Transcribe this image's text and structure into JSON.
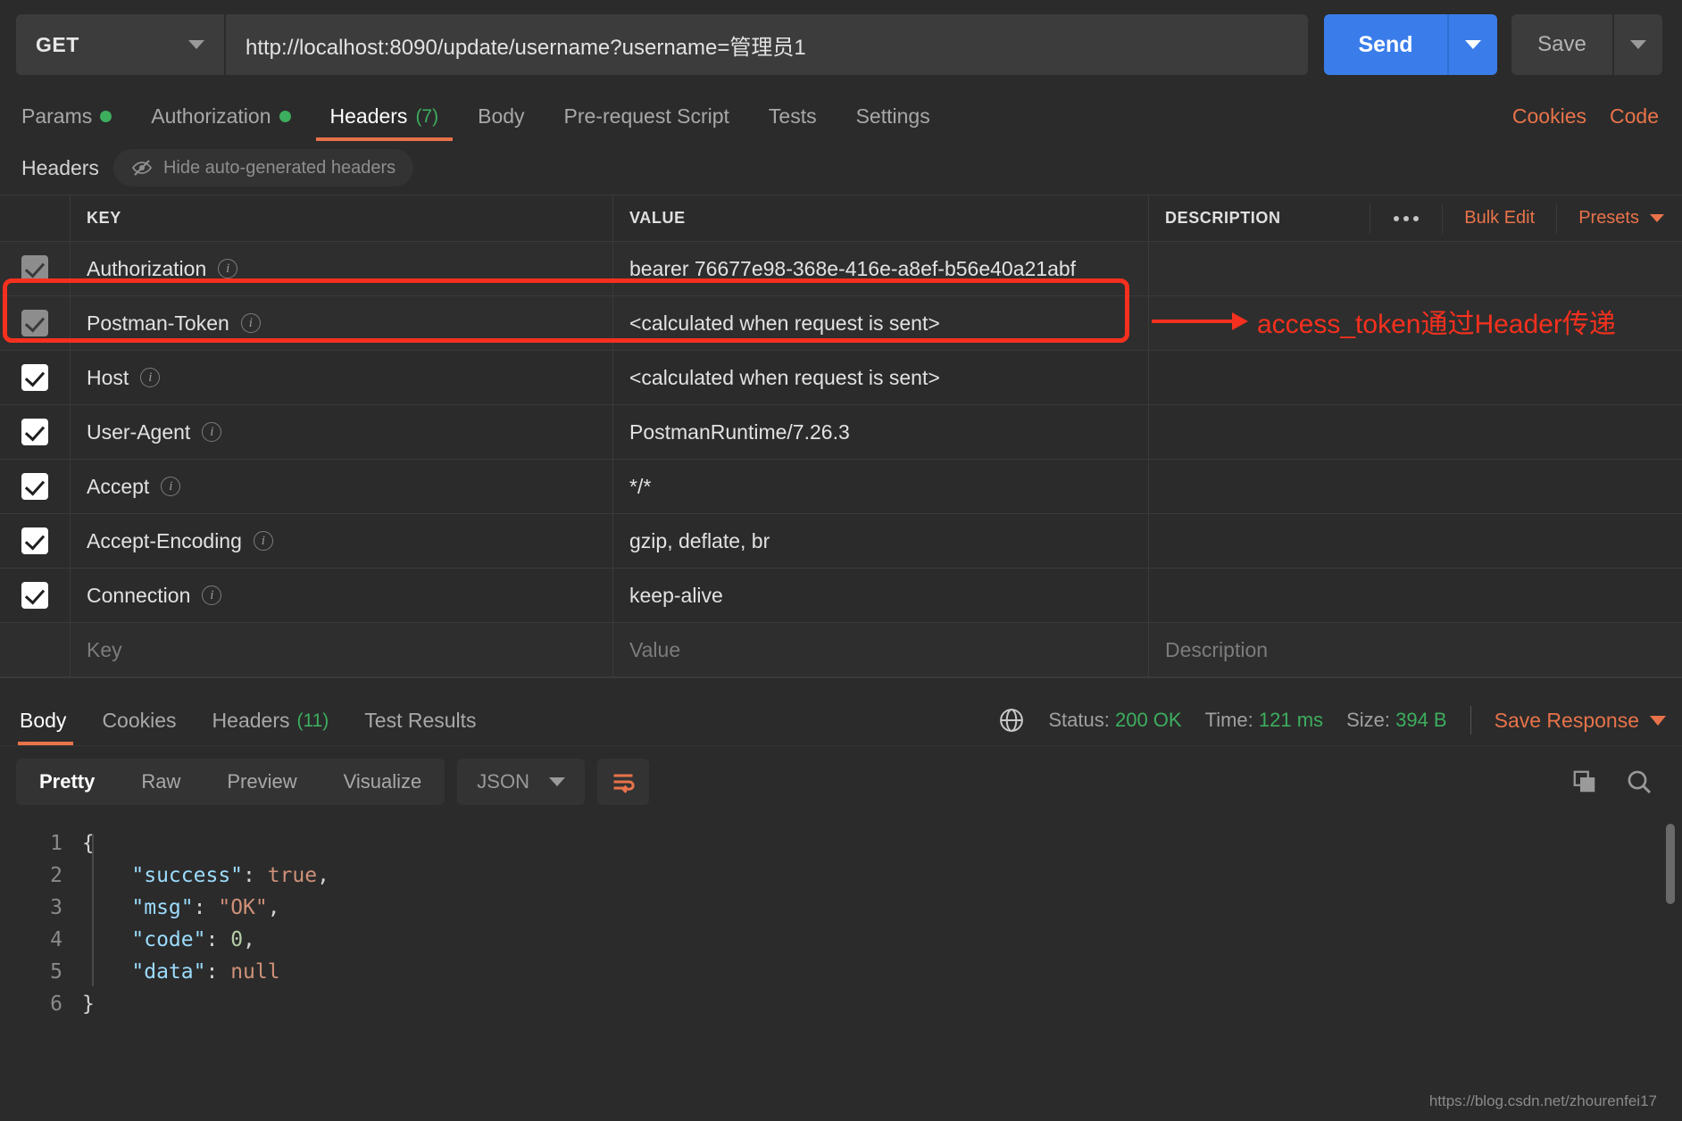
{
  "request": {
    "method": "GET",
    "url": "http://localhost:8090/update/username?username=管理员1",
    "send_label": "Send",
    "save_label": "Save"
  },
  "request_tabs": [
    {
      "label": "Params",
      "badge": "dot",
      "active": false
    },
    {
      "label": "Authorization",
      "badge": "dot",
      "active": false
    },
    {
      "label": "Headers",
      "badge": "(7)",
      "active": true
    },
    {
      "label": "Body",
      "badge": "",
      "active": false
    },
    {
      "label": "Pre-request Script",
      "badge": "",
      "active": false
    },
    {
      "label": "Tests",
      "badge": "",
      "active": false
    },
    {
      "label": "Settings",
      "badge": "",
      "active": false
    }
  ],
  "tabs_right": [
    {
      "label": "Cookies"
    },
    {
      "label": "Code"
    }
  ],
  "headers_panel": {
    "title": "Headers",
    "hide_auto_label": "Hide auto-generated headers",
    "columns": {
      "key": "KEY",
      "value": "VALUE",
      "description": "DESCRIPTION"
    },
    "bulk_edit": "Bulk Edit",
    "presets": "Presets",
    "placeholder_row": {
      "key": "Key",
      "value": "Value",
      "description": "Description"
    },
    "rows": [
      {
        "checked": true,
        "auto": true,
        "key": "Authorization",
        "value": "bearer 76677e98-368e-416e-a8ef-b56e40a21abf",
        "description": ""
      },
      {
        "checked": true,
        "auto": true,
        "key": "Postman-Token",
        "value": "<calculated when request is sent>",
        "description": ""
      },
      {
        "checked": true,
        "auto": false,
        "key": "Host",
        "value": "<calculated when request is sent>",
        "description": ""
      },
      {
        "checked": true,
        "auto": false,
        "key": "User-Agent",
        "value": "PostmanRuntime/7.26.3",
        "description": ""
      },
      {
        "checked": true,
        "auto": false,
        "key": "Accept",
        "value": "*/*",
        "description": ""
      },
      {
        "checked": true,
        "auto": false,
        "key": "Accept-Encoding",
        "value": "gzip, deflate, br",
        "description": ""
      },
      {
        "checked": true,
        "auto": false,
        "key": "Connection",
        "value": "keep-alive",
        "description": ""
      }
    ]
  },
  "annotation": {
    "text": "access_token通过Header传递",
    "color": "#f5301e"
  },
  "response": {
    "tabs": [
      {
        "label": "Body",
        "badge": "",
        "active": true
      },
      {
        "label": "Cookies",
        "badge": "",
        "active": false
      },
      {
        "label": "Headers",
        "badge": "(11)",
        "active": false
      },
      {
        "label": "Test Results",
        "badge": "",
        "active": false
      }
    ],
    "status_label": "Status:",
    "status_value": "200 OK",
    "time_label": "Time:",
    "time_value": "121 ms",
    "size_label": "Size:",
    "size_value": "394 B",
    "save_response": "Save Response",
    "view_modes": [
      {
        "label": "Pretty",
        "active": true
      },
      {
        "label": "Raw",
        "active": false
      },
      {
        "label": "Preview",
        "active": false
      },
      {
        "label": "Visualize",
        "active": false
      }
    ],
    "format": "JSON",
    "body_lines": [
      {
        "n": "1",
        "tokens": [
          {
            "t": "punc",
            "s": "{"
          }
        ]
      },
      {
        "n": "2",
        "tokens": [
          {
            "t": "punc",
            "s": "    "
          },
          {
            "t": "key",
            "s": "\"success\""
          },
          {
            "t": "punc",
            "s": ": "
          },
          {
            "t": "lit",
            "s": "true"
          },
          {
            "t": "punc",
            "s": ","
          }
        ]
      },
      {
        "n": "3",
        "tokens": [
          {
            "t": "punc",
            "s": "    "
          },
          {
            "t": "key",
            "s": "\"msg\""
          },
          {
            "t": "punc",
            "s": ": "
          },
          {
            "t": "str",
            "s": "\"OK\""
          },
          {
            "t": "punc",
            "s": ","
          }
        ]
      },
      {
        "n": "4",
        "tokens": [
          {
            "t": "punc",
            "s": "    "
          },
          {
            "t": "key",
            "s": "\"code\""
          },
          {
            "t": "punc",
            "s": ": "
          },
          {
            "t": "num",
            "s": "0"
          },
          {
            "t": "punc",
            "s": ","
          }
        ]
      },
      {
        "n": "5",
        "tokens": [
          {
            "t": "punc",
            "s": "    "
          },
          {
            "t": "key",
            "s": "\"data\""
          },
          {
            "t": "punc",
            "s": ": "
          },
          {
            "t": "lit",
            "s": "null"
          }
        ]
      },
      {
        "n": "6",
        "tokens": [
          {
            "t": "punc",
            "s": "}"
          }
        ]
      }
    ]
  },
  "watermark": "https://blog.csdn.net/zhourenfei17"
}
